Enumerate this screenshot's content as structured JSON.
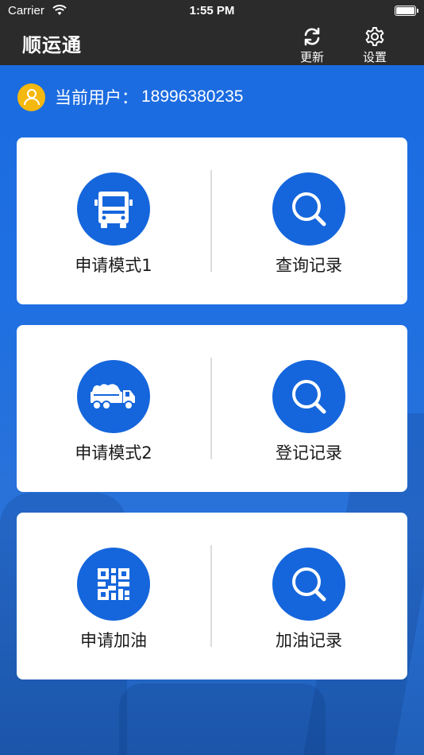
{
  "status_bar": {
    "carrier": "Carrier",
    "time": "1:55 PM"
  },
  "navbar": {
    "title": "顺运通",
    "refresh": {
      "label": "更新",
      "icon": "refresh-icon"
    },
    "settings": {
      "label": "设置",
      "icon": "gear-icon"
    }
  },
  "user": {
    "label": "当前用户：",
    "phone": "18996380235",
    "icon": "user-icon"
  },
  "cards": [
    {
      "left": {
        "label": "申请模式1",
        "icon": "truck-front-icon"
      },
      "right": {
        "label": "查询记录",
        "icon": "search-icon"
      }
    },
    {
      "left": {
        "label": "申请模式2",
        "icon": "dump-truck-icon"
      },
      "right": {
        "label": "登记记录",
        "icon": "search-icon"
      }
    },
    {
      "left": {
        "label": "申请加油",
        "icon": "qr-code-icon"
      },
      "right": {
        "label": "加油记录",
        "icon": "search-icon"
      }
    }
  ],
  "colors": {
    "background": "#1f6ee0",
    "navbar": "#2b2b2b",
    "accent": "#1566dc",
    "avatar": "#f5b80f"
  }
}
